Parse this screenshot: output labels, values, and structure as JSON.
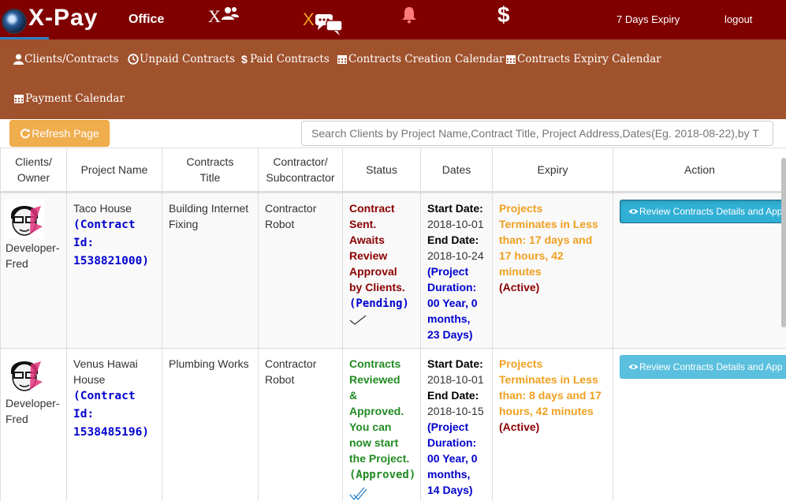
{
  "topbar": {
    "logo": "X-Pay",
    "office": "Office",
    "clients_icon_x": "X",
    "messages_icon_x": "X",
    "dollar": "$",
    "expiry": "7 Days Expiry",
    "logout": "logout",
    "colors": {
      "bar": "#800000",
      "accent": "#f0a020"
    }
  },
  "subnav": {
    "items": [
      {
        "label": "Clients/Contracts",
        "icon": "user-icon"
      },
      {
        "label": "Unpaid Contracts",
        "icon": "clock-icon"
      },
      {
        "label": "Paid Contracts",
        "icon": "dollar-icon"
      },
      {
        "label": "Contracts Creation Calendar",
        "icon": "calendar-icon"
      },
      {
        "label": "Contracts Expiry Calendar",
        "icon": "calendar-icon"
      },
      {
        "label": "Payment Calendar",
        "icon": "calendar-icon"
      }
    ],
    "color": "#a0522d"
  },
  "toolbar": {
    "refresh": "Refresh Page",
    "search_placeholder": "Search Clients by Project Name,Contract Title, Project Address,Dates(Eg. 2018-08-22),by T"
  },
  "table": {
    "headers": {
      "owner_1": "Clients/",
      "owner_2": "Owner",
      "project": "Project Name",
      "title_1": "Contracts",
      "title_2": "Title",
      "contractor_1": "Contractor/",
      "contractor_2": "Subcontractor",
      "status": "Status",
      "dates": "Dates",
      "expiry": "Expiry",
      "action": "Action"
    },
    "rows": [
      {
        "owner_1": "Developer-",
        "owner_2": "Fred",
        "project_1": "Taco House",
        "cid_1": "(Contract",
        "cid_2": "Id:",
        "cid_3": "1538821000)",
        "title_1": "Building Internet",
        "title_2": "Fixing",
        "contractor_1": "Contractor",
        "contractor_2": "Robot",
        "status_1": "Contract",
        "status_2": "Sent.",
        "status_3": "Awaits",
        "status_4": "Review",
        "status_5": "Approval",
        "status_6": "by Clients.",
        "status_tag": "(Pending)",
        "start_label": "Start Date:",
        "start": "2018-10-01",
        "end_label": "End Date:",
        "end": "2018-10-24",
        "dur_1": "(Project",
        "dur_2": "Duration:",
        "dur_3": "00 Year, 0",
        "dur_4": "months,",
        "dur_5": "23 Days)",
        "exp_1": "Projects",
        "exp_2": "Terminates in Less",
        "exp_3": "than: 17 days and",
        "exp_4": "17 hours, 42",
        "exp_5": "minutes",
        "exp_state": "(Active)",
        "action": "Review Contracts Details and App"
      },
      {
        "owner_1": "Developer-",
        "owner_2": "Fred",
        "project_1": "Venus Hawai",
        "project_2": "House",
        "cid_1": "(Contract",
        "cid_2": "Id:",
        "cid_3": "1538485196)",
        "title_1": "Plumbing Works",
        "contractor_1": "Contractor",
        "contractor_2": "Robot",
        "status_1": "Contracts",
        "status_2": "Reviewed",
        "status_3": "&",
        "status_4": "Approved.",
        "status_5": "You can",
        "status_6": "now start",
        "status_7": "the Project.",
        "status_tag": "(Approved)",
        "start_label": "Start Date:",
        "start": "2018-10-01",
        "end_label": "End Date:",
        "end": "2018-10-15",
        "dur_1": "(Project",
        "dur_2": "Duration:",
        "dur_3": "00 Year, 0",
        "dur_4": "months,",
        "dur_5": "14 Days)",
        "exp_1": "Projects",
        "exp_2": "Terminates in Less",
        "exp_3": "than: 8 days and 17",
        "exp_4": "hours, 42 minutes",
        "exp_state": "(Active)",
        "action": "Review Contracts Details and App"
      }
    ]
  }
}
